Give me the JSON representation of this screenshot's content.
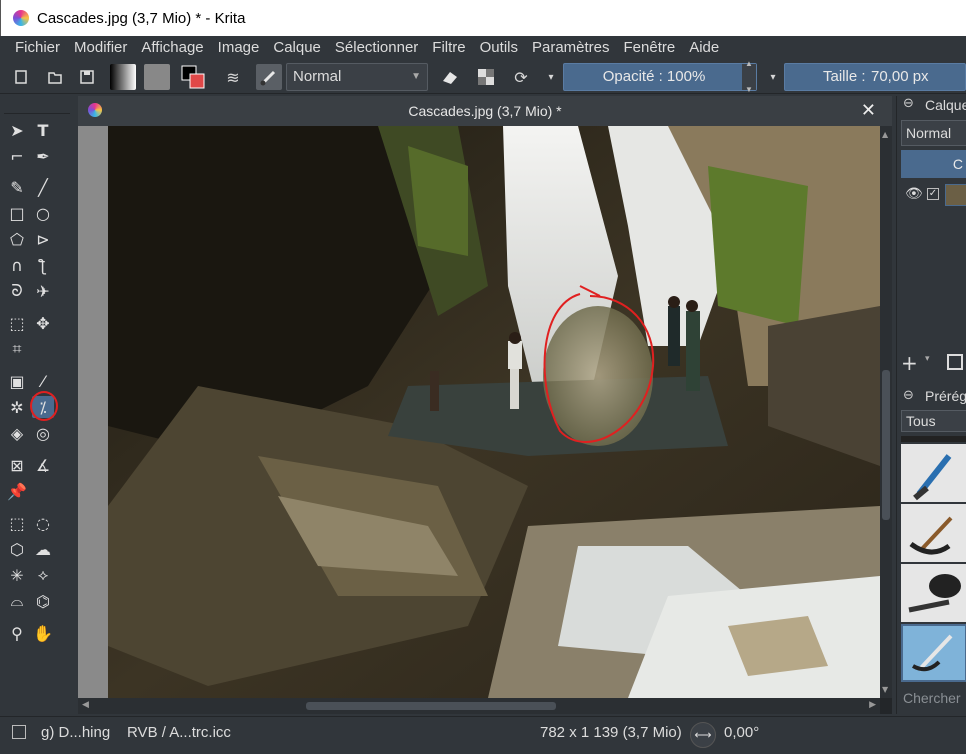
{
  "window": {
    "title": "Cascades.jpg (3,7 Mio) * - Krita"
  },
  "menu": [
    {
      "label": "Fichier"
    },
    {
      "label": "Modifier"
    },
    {
      "label": "Affichage"
    },
    {
      "label": "Image"
    },
    {
      "label": "Calque"
    },
    {
      "label": "Sélectionner"
    },
    {
      "label": "Filtre"
    },
    {
      "label": "Outils"
    },
    {
      "label": "Paramètres"
    },
    {
      "label": "Fenêtre"
    },
    {
      "label": "Aide"
    }
  ],
  "toolbar": {
    "blend_mode": "Normal",
    "opacity_label": "Opacité : 100%",
    "opacity_value": 1.0,
    "size_label": "Taille : ",
    "size_value": "70,00 px"
  },
  "canvas": {
    "tab_title": "Cascades.jpg (3,7 Mio) *",
    "close_glyph": "✕"
  },
  "right_panel": {
    "layers_title": "Calque",
    "layers_blend": "Normal",
    "layers_button": "C",
    "presets_title": "Prérégl",
    "presets_filter": "Tous",
    "search_placeholder": "Chercher"
  },
  "status": {
    "tool_info": "g) D...hing",
    "color_profile": "RVB / A...trc.icc",
    "image_size": "782 x 1 139 (3,7 Mio)",
    "rotation": "0,00°"
  },
  "colors": {
    "accent": "#4a6a8e",
    "highlight_circle": "#e02020",
    "bg": "#31363b"
  }
}
